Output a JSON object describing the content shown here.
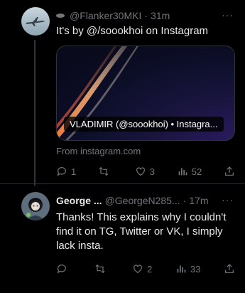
{
  "tweets": [
    {
      "display_name": "",
      "handle": "@Flanker30MKI",
      "time": "31m",
      "text": "It's by @/soookhoi on Instagram",
      "card": {
        "caption": "VLADIMIR (@soookhoi) • Instagra...",
        "source": "From instagram.com"
      },
      "actions": {
        "replies": "1",
        "retweets": "",
        "likes": "3",
        "views": "52"
      }
    },
    {
      "display_name": "George ...",
      "handle": "@GeorgeN285...",
      "time": "17m",
      "text": "Thanks! This explains why I couldn't find it on TG, Twitter or VK, I simply lack insta.",
      "actions": {
        "replies": "",
        "retweets": "",
        "likes": "2",
        "views": "33"
      }
    }
  ],
  "more_label": "···",
  "dot": "·",
  "icons": [
    "reply-icon",
    "retweet-icon",
    "like-icon",
    "views-icon",
    "share-icon",
    "more-icon"
  ]
}
